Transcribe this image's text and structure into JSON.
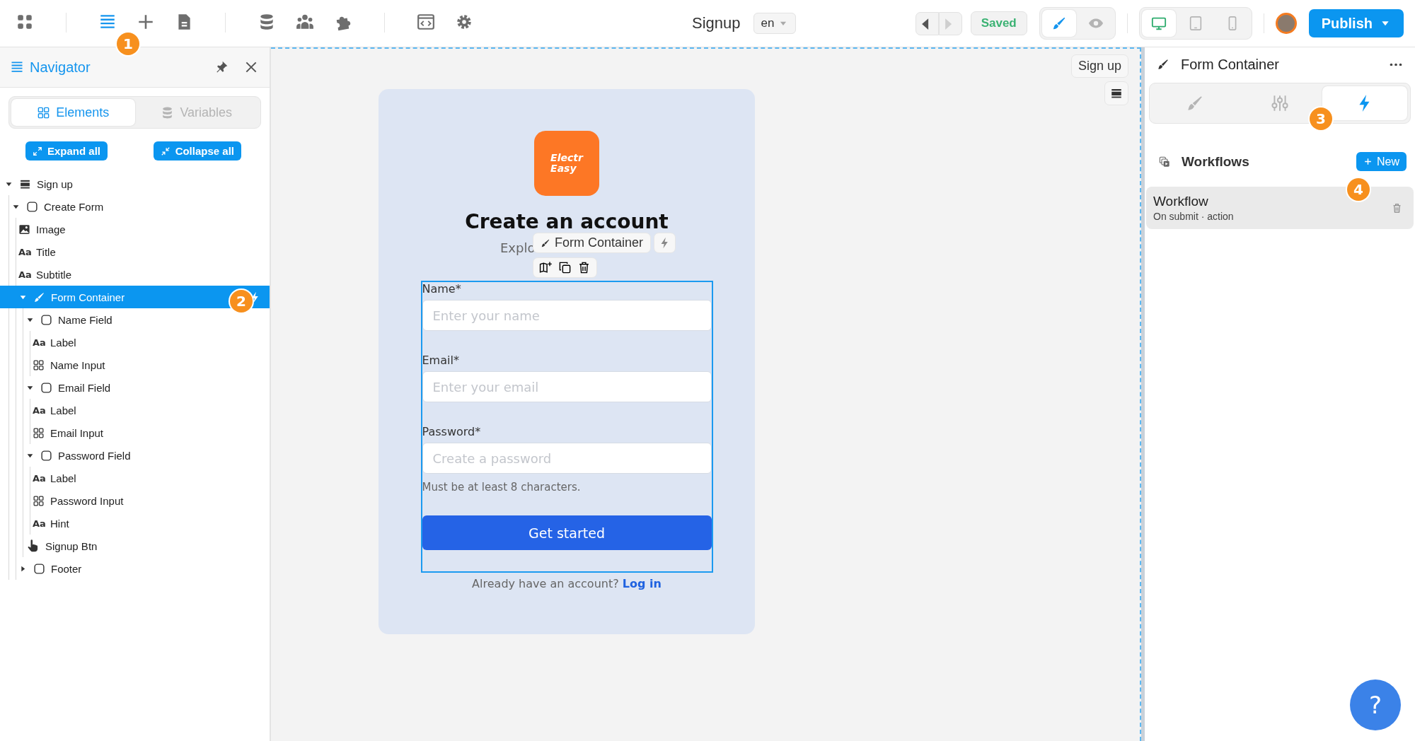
{
  "toolbar": {
    "tool_groups": [
      {
        "tools": [
          {
            "kind": "apps",
            "selected": false
          }
        ]
      },
      {
        "tools": [
          {
            "kind": "navigator",
            "selected": true,
            "badge": "1"
          },
          {
            "kind": "add",
            "selected": false
          },
          {
            "kind": "pages",
            "selected": false
          }
        ]
      },
      {
        "tools": [
          {
            "kind": "database",
            "selected": false
          },
          {
            "kind": "users",
            "selected": false
          },
          {
            "kind": "plugins",
            "selected": false
          }
        ]
      },
      {
        "tools": [
          {
            "kind": "code",
            "selected": false
          },
          {
            "kind": "settings",
            "selected": false
          }
        ]
      }
    ],
    "page_title": "Signup",
    "language": "en",
    "history": [
      {
        "kind": "back",
        "disabled": false
      },
      {
        "kind": "forward",
        "disabled": true
      }
    ],
    "save_status": "Saved",
    "modes": [
      {
        "kind": "design",
        "selected": true
      },
      {
        "kind": "preview",
        "selected": false
      }
    ],
    "devices": [
      {
        "kind": "desktop",
        "selected": true
      },
      {
        "kind": "tablet",
        "selected": false
      },
      {
        "kind": "mobile",
        "selected": false
      }
    ],
    "publish": "Publish"
  },
  "navigator": {
    "title": "Navigator",
    "tabs": [
      {
        "label": "Elements",
        "selected": true
      },
      {
        "label": "Variables",
        "selected": false
      }
    ],
    "expand_all": "Expand all",
    "collapse_all": "Collapse all",
    "tree": [
      {
        "label": "Sign up",
        "kind": "section",
        "expanded": true,
        "selected": false,
        "children": [
          {
            "label": "Create Form",
            "kind": "box",
            "expanded": true,
            "selected": false,
            "children": [
              {
                "label": "Image",
                "kind": "image",
                "selected": false
              },
              {
                "label": "Title",
                "kind": "text",
                "glyph": "Aa",
                "selected": false
              },
              {
                "label": "Subtitle",
                "kind": "text",
                "glyph": "Aa",
                "selected": false
              },
              {
                "label": "Form Container",
                "kind": "brush",
                "expanded": true,
                "selected": true,
                "has_workflow": true,
                "badge": "2",
                "children": [
                  {
                    "label": "Name Field",
                    "kind": "box",
                    "expanded": true,
                    "selected": false,
                    "children": [
                      {
                        "label": "Label",
                        "kind": "text",
                        "glyph": "Aa",
                        "selected": false
                      },
                      {
                        "label": "Name Input",
                        "kind": "grid",
                        "selected": false
                      }
                    ]
                  },
                  {
                    "label": "Email Field",
                    "kind": "box",
                    "expanded": true,
                    "selected": false,
                    "children": [
                      {
                        "label": "Label",
                        "kind": "text",
                        "glyph": "Aa",
                        "selected": false
                      },
                      {
                        "label": "Email Input",
                        "kind": "grid",
                        "selected": false
                      }
                    ]
                  },
                  {
                    "label": "Password Field",
                    "kind": "box",
                    "expanded": true,
                    "selected": false,
                    "children": [
                      {
                        "label": "Label",
                        "kind": "text",
                        "glyph": "Aa",
                        "selected": false
                      },
                      {
                        "label": "Password Input",
                        "kind": "grid",
                        "selected": false
                      },
                      {
                        "label": "Hint",
                        "kind": "text",
                        "glyph": "Aa",
                        "selected": false
                      }
                    ]
                  },
                  {
                    "label": "Signup Btn",
                    "kind": "hand",
                    "selected": false
                  }
                ]
              },
              {
                "label": "Footer",
                "kind": "box",
                "expanded": false,
                "selected": false
              }
            ]
          }
        ]
      }
    ]
  },
  "canvas": {
    "page_label": "Sign up",
    "logo_lines": [
      "Electr",
      "Easy"
    ],
    "title": "Create an account",
    "subtitle": "Explo",
    "selection_label": "Form Container",
    "fields": [
      {
        "label": "Name*",
        "placeholder": "Enter your name"
      },
      {
        "label": "Email*",
        "placeholder": "Enter your email"
      },
      {
        "label": "Password*",
        "placeholder": "Create a password"
      }
    ],
    "hint": "Must be at least 8 characters.",
    "submit": "Get started",
    "footer_text": "Already have an account?",
    "footer_link": "Log in"
  },
  "inspector": {
    "title": "Form Container",
    "tabs": [
      {
        "kind": "style",
        "selected": false
      },
      {
        "kind": "settings",
        "selected": false
      },
      {
        "kind": "interactions",
        "selected": true,
        "badge": "3"
      }
    ],
    "section_title": "Workflows",
    "new_button": "New",
    "workflows": [
      {
        "name": "Workflow",
        "trigger": "On submit · action",
        "badge": "4"
      }
    ]
  },
  "help": "?"
}
